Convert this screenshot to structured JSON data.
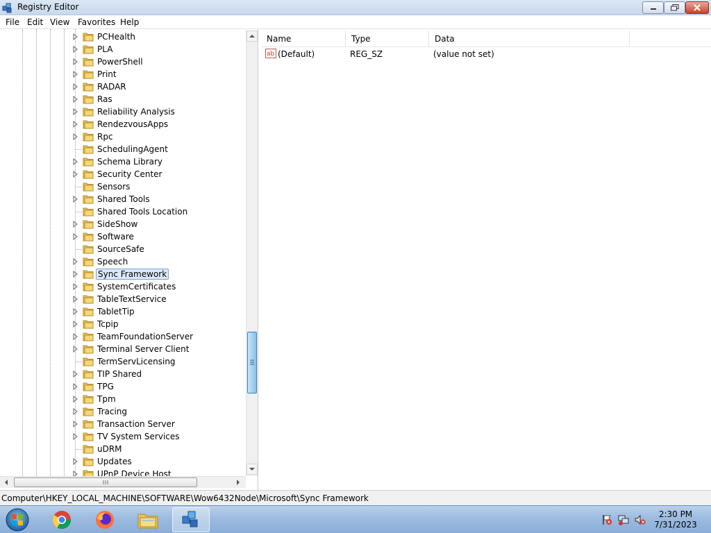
{
  "window": {
    "title": "Registry Editor"
  },
  "menu": [
    "File",
    "Edit",
    "View",
    "Favorites",
    "Help"
  ],
  "tree": {
    "items": [
      {
        "label": "PCHealth",
        "expandable": true
      },
      {
        "label": "PLA",
        "expandable": true
      },
      {
        "label": "PowerShell",
        "expandable": true
      },
      {
        "label": "Print",
        "expandable": true
      },
      {
        "label": "RADAR",
        "expandable": true
      },
      {
        "label": "Ras",
        "expandable": true
      },
      {
        "label": "Reliability Analysis",
        "expandable": true
      },
      {
        "label": "RendezvousApps",
        "expandable": true
      },
      {
        "label": "Rpc",
        "expandable": true
      },
      {
        "label": "SchedulingAgent",
        "expandable": false
      },
      {
        "label": "Schema Library",
        "expandable": true
      },
      {
        "label": "Security Center",
        "expandable": true
      },
      {
        "label": "Sensors",
        "expandable": false
      },
      {
        "label": "Shared Tools",
        "expandable": true
      },
      {
        "label": "Shared Tools Location",
        "expandable": false
      },
      {
        "label": "SideShow",
        "expandable": true
      },
      {
        "label": "Software",
        "expandable": true
      },
      {
        "label": "SourceSafe",
        "expandable": false
      },
      {
        "label": "Speech",
        "expandable": true
      },
      {
        "label": "Sync Framework",
        "expandable": true,
        "selected": true
      },
      {
        "label": "SystemCertificates",
        "expandable": true
      },
      {
        "label": "TableTextService",
        "expandable": true
      },
      {
        "label": "TabletTip",
        "expandable": true
      },
      {
        "label": "Tcpip",
        "expandable": true
      },
      {
        "label": "TeamFoundationServer",
        "expandable": true
      },
      {
        "label": "Terminal Server Client",
        "expandable": true
      },
      {
        "label": "TermServLicensing",
        "expandable": false
      },
      {
        "label": "TIP Shared",
        "expandable": true
      },
      {
        "label": "TPG",
        "expandable": true
      },
      {
        "label": "Tpm",
        "expandable": true
      },
      {
        "label": "Tracing",
        "expandable": true
      },
      {
        "label": "Transaction Server",
        "expandable": true
      },
      {
        "label": "TV System Services",
        "expandable": true
      },
      {
        "label": "uDRM",
        "expandable": false
      },
      {
        "label": "Updates",
        "expandable": true
      },
      {
        "label": "UPnP Device Host",
        "expandable": true
      }
    ]
  },
  "values": {
    "columns": [
      "Name",
      "Type",
      "Data"
    ],
    "rows": [
      {
        "name": "(Default)",
        "type": "REG_SZ",
        "data": "(value not set)",
        "icon": "string-value-icon"
      }
    ]
  },
  "status": {
    "path": "Computer\\HKEY_LOCAL_MACHINE\\SOFTWARE\\Wow6432Node\\Microsoft\\Sync Framework"
  },
  "taskbar": {
    "apps": [
      "chrome-icon",
      "firefox-icon",
      "file-explorer-icon",
      "regedit-icon"
    ],
    "tray": [
      "action-center-flag-icon",
      "network-icon",
      "volume-muted-icon"
    ],
    "time": "2:30 PM",
    "date": "7/31/2023"
  },
  "colors": {
    "selection_bg": "#dbe9f8",
    "selection_border": "#7da2ce",
    "taskbar": "#9dbbe0"
  }
}
